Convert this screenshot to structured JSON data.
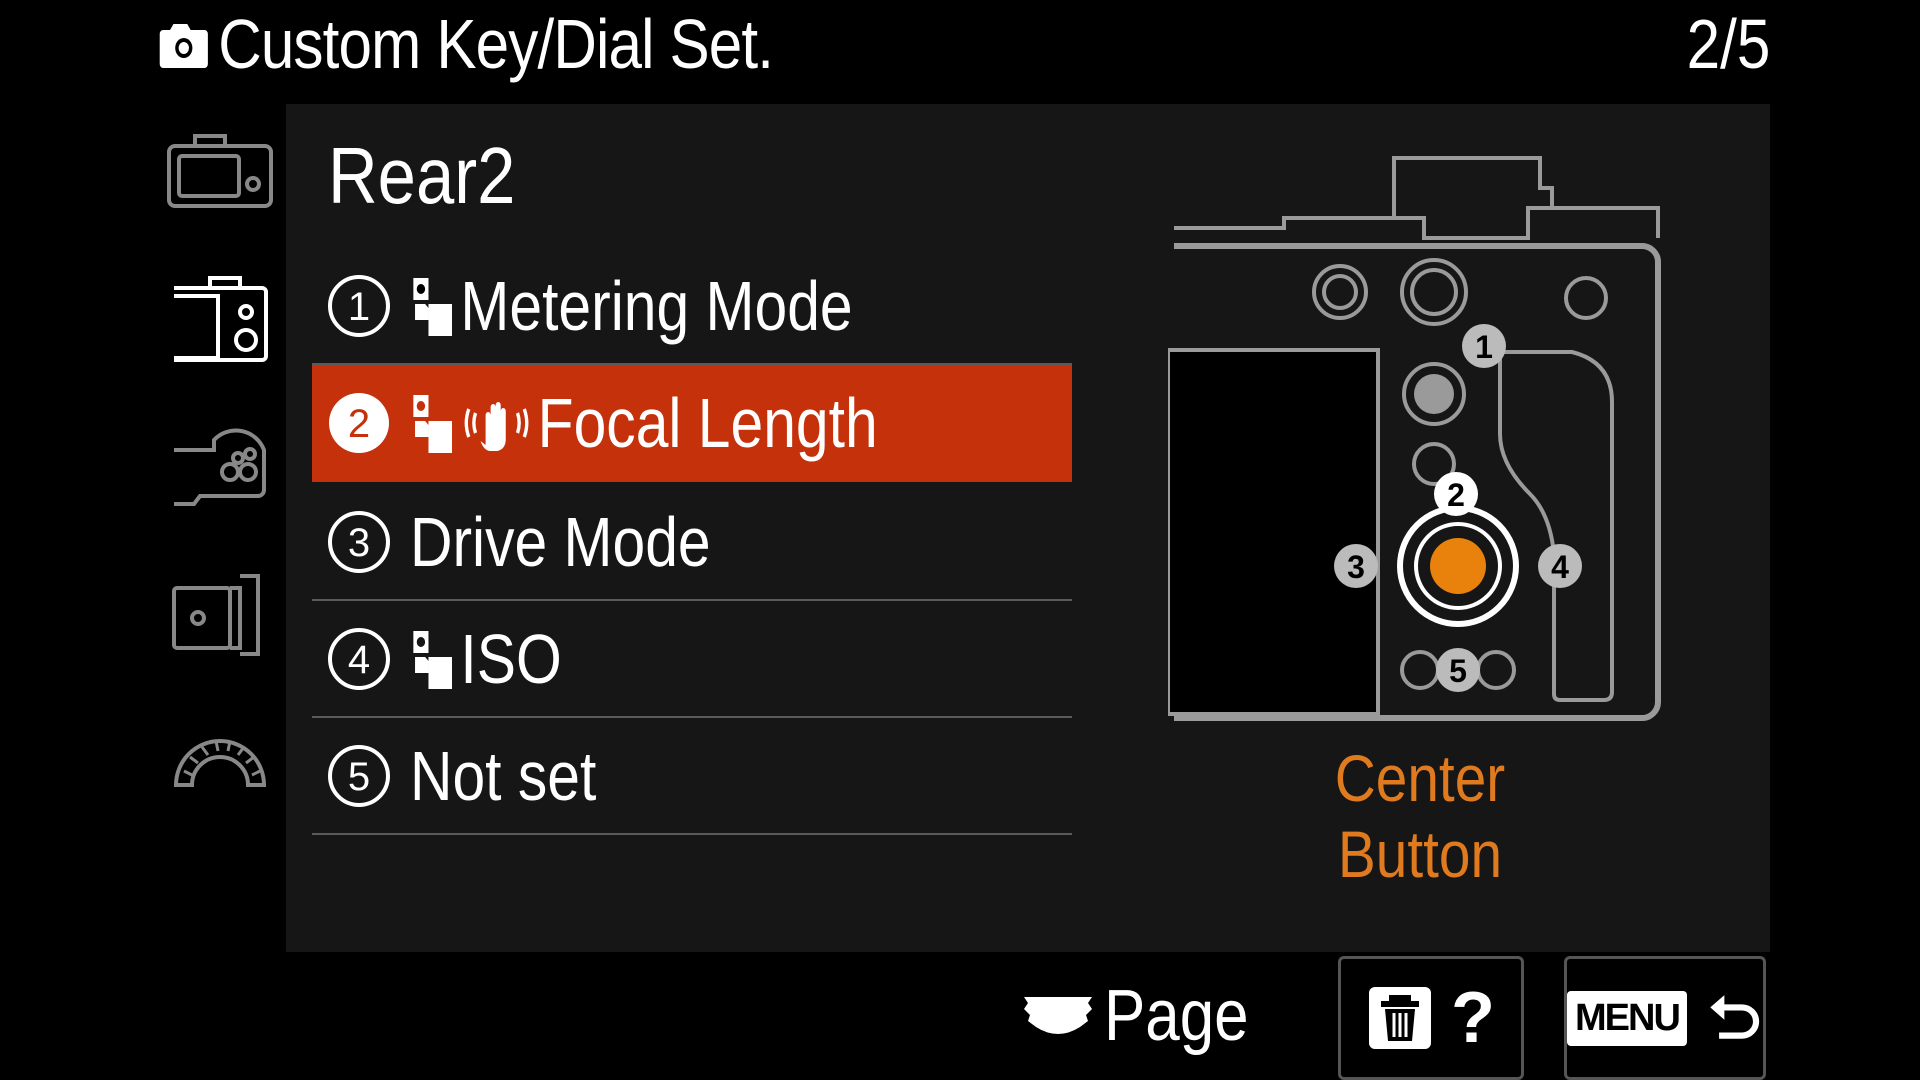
{
  "header": {
    "title": "Custom Key/Dial Set.",
    "page_counter": "2/5"
  },
  "side_tabs": [
    {
      "icon": "camera-body-front-icon"
    },
    {
      "icon": "camera-body-rear-icon"
    },
    {
      "icon": "camera-grip-icon"
    },
    {
      "icon": "camera-side-icon"
    },
    {
      "icon": "dial-icon"
    }
  ],
  "panel": {
    "title": "Rear2",
    "items": [
      {
        "num": "1",
        "label": "Metering Mode",
        "icons": [
          "still-movie-icon"
        ],
        "selected": false
      },
      {
        "num": "2",
        "label": "Focal Length",
        "icons": [
          "still-movie-icon",
          "steadyshot-hand-icon"
        ],
        "selected": true
      },
      {
        "num": "3",
        "label": "Drive Mode",
        "icons": [],
        "selected": false
      },
      {
        "num": "4",
        "label": "ISO",
        "icons": [
          "still-movie-icon"
        ],
        "selected": false
      },
      {
        "num": "5",
        "label": "Not set",
        "icons": [],
        "selected": false
      }
    ],
    "diagram_caption": "Center Button",
    "diagram_markers": [
      "1",
      "2",
      "3",
      "4",
      "5"
    ]
  },
  "footer": {
    "page_label": "Page",
    "delete_help_label": "?",
    "menu_label": "MENU"
  },
  "colors": {
    "accent": "#c4310a",
    "highlight_orange": "#e8820c",
    "caption": "#e07a1f"
  }
}
